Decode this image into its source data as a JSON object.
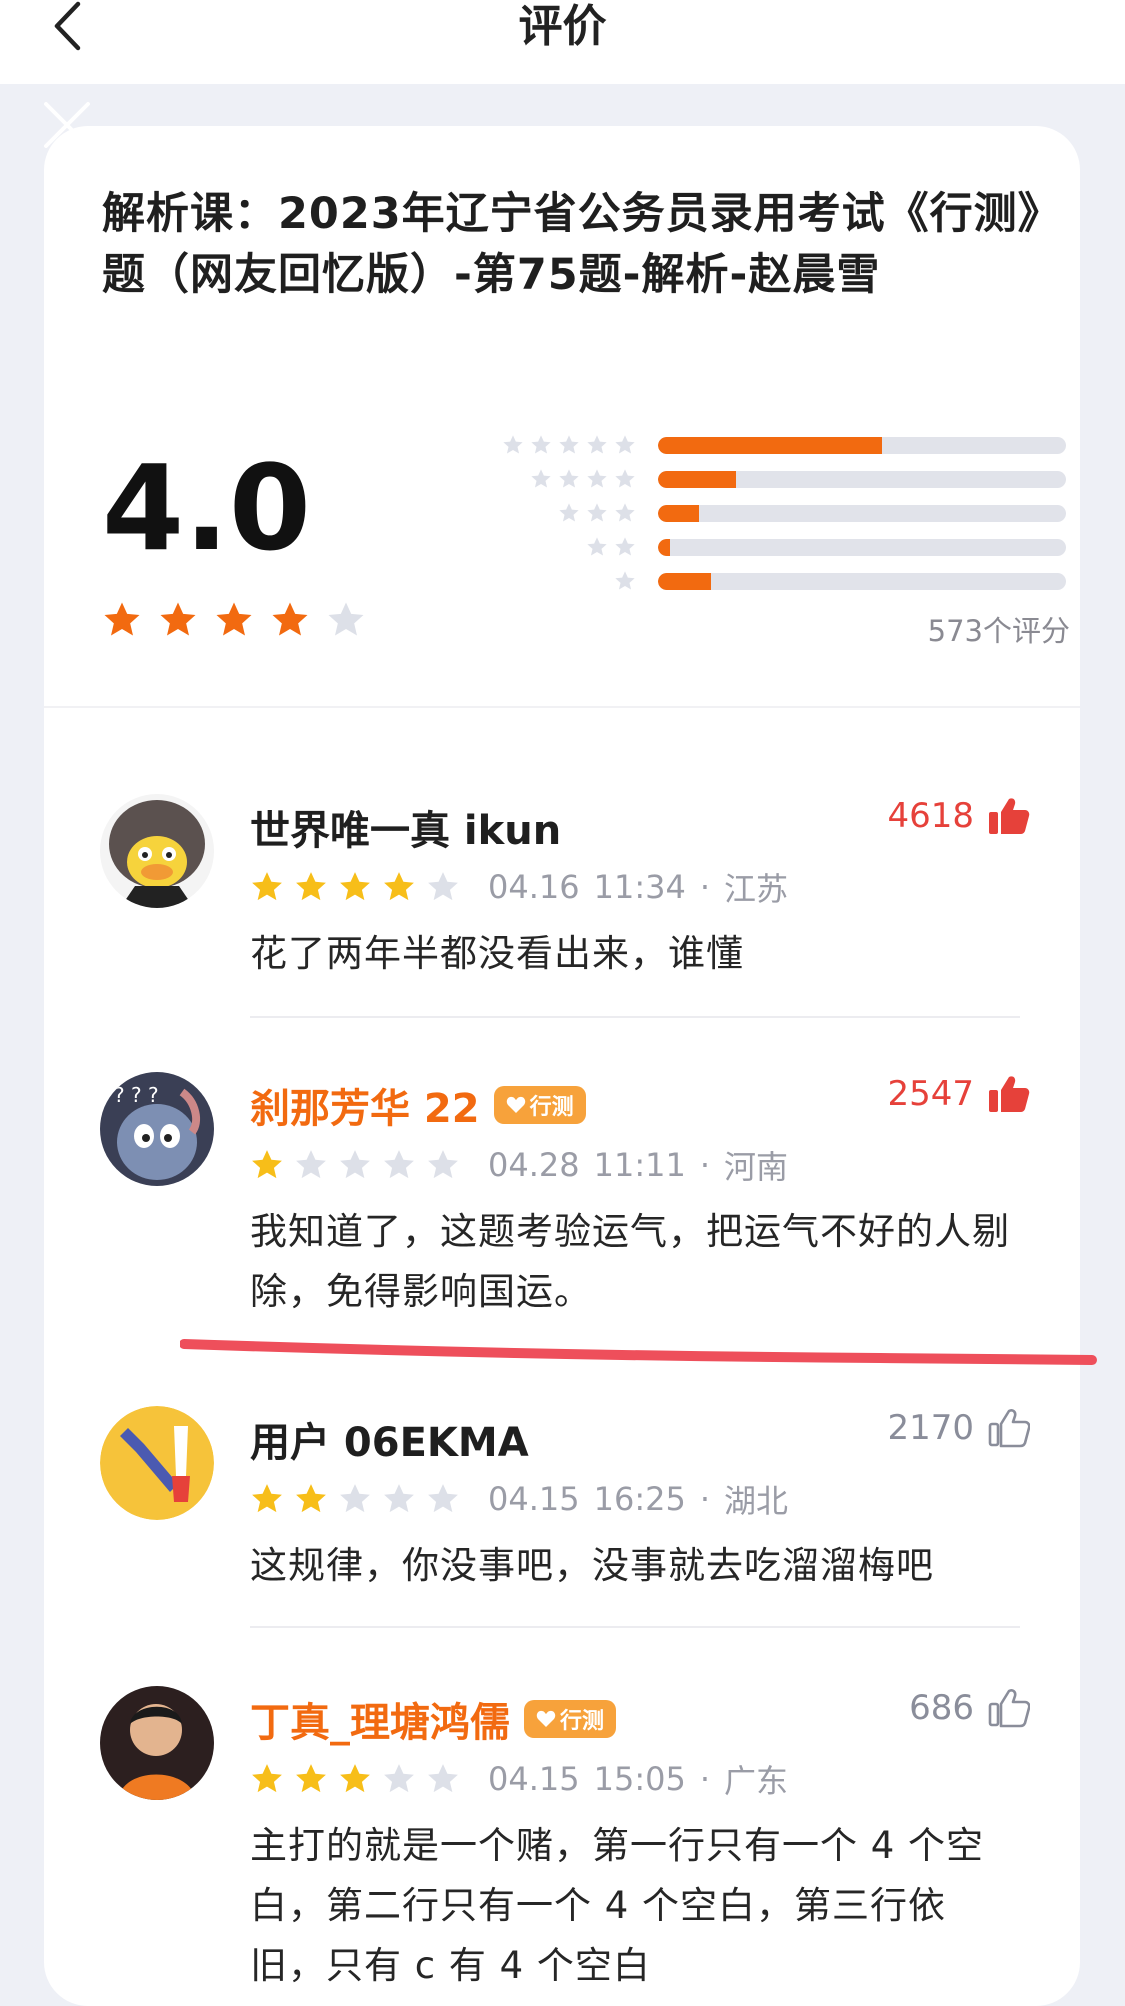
{
  "header": {
    "title": "评价",
    "back_icon": "chevron-left-icon"
  },
  "course": {
    "title": "解析课：2023年辽宁省公务员录用考试《行测》题（网友回忆版）-第75题-解析-赵晨雪"
  },
  "rating": {
    "score": "4.0",
    "stars": 4,
    "max_stars": 5,
    "count_label": "573个评分",
    "distribution": [
      {
        "stars": 5,
        "fraction": 0.55
      },
      {
        "stars": 4,
        "fraction": 0.19
      },
      {
        "stars": 3,
        "fraction": 0.1
      },
      {
        "stars": 2,
        "fraction": 0.03
      },
      {
        "stars": 1,
        "fraction": 0.13
      }
    ]
  },
  "colors": {
    "accent": "#f26a10",
    "star_filled": "#f26a10",
    "star_empty": "#dde0e8",
    "like_active": "#e6413a",
    "review_star": "#f7be19"
  },
  "reviews": [
    {
      "name": "世界唯一真 ikun",
      "tag": "",
      "likes": "4618",
      "liked": true,
      "stars": 4,
      "date": "04.16",
      "time": "11:34",
      "location": "江苏",
      "text": "花了两年半都没看出来，谁懂"
    },
    {
      "name": "刹那芳华 22",
      "tag": "行测",
      "likes": "2547",
      "liked": true,
      "stars": 1,
      "date": "04.28",
      "time": "11:11",
      "location": "河南",
      "text": "我知道了，这题考验运气，把运气不好的人剔除，免得影响国运。"
    },
    {
      "name": "用户 06EKMA",
      "tag": "",
      "likes": "2170",
      "liked": false,
      "stars": 2,
      "date": "04.15",
      "time": "16:25",
      "location": "湖北",
      "text": "这规律，你没事吧，没事就去吃溜溜梅吧"
    },
    {
      "name": "丁真_理塘鸿儒",
      "tag": "行测",
      "likes": "686",
      "liked": false,
      "stars": 3,
      "date": "04.15",
      "time": "15:05",
      "location": "广东",
      "text": "主打的就是一个赌，第一行只有一个 4 个空白，第二行只有一个 4 个空白，第三行依旧，只有 c 有 4 个空白"
    }
  ],
  "separator_dot": "·"
}
